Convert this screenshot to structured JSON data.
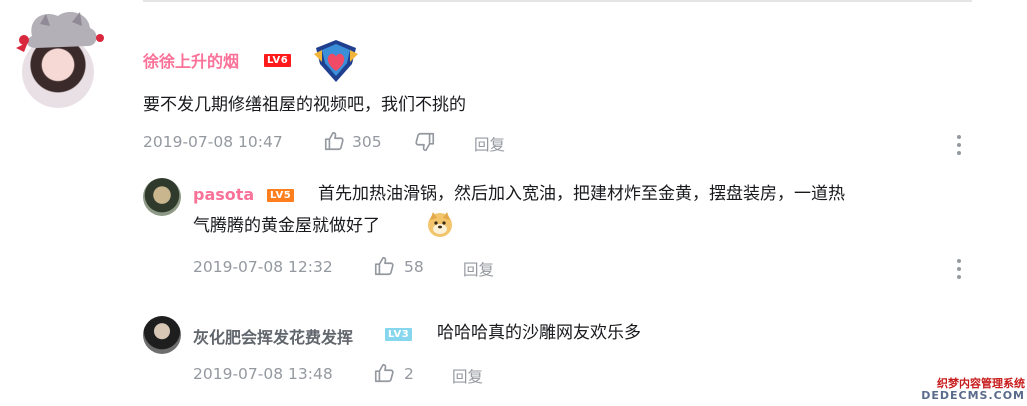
{
  "comments": [
    {
      "username": "徐徐上升的烟",
      "level": "LV6",
      "text": "要不发几期修缮祖屋的视频吧，我们不挑的",
      "time": "2019-07-08 10:47",
      "likes": "305",
      "reply_label": "回复"
    }
  ],
  "replies": [
    {
      "username": "pasota",
      "level": "LV5",
      "text_line1": "首先加热油滑锅，然后加入宽油，把建材炸至金黄，摆盘装房，一道热",
      "text_line2": "气腾腾的黄金屋就做好了",
      "emoji": "doge",
      "time": "2019-07-08 12:32",
      "likes": "58",
      "reply_label": "回复"
    },
    {
      "username": "灰化肥会挥发花费发挥",
      "level": "LV3",
      "text": "哈哈哈真的沙雕网友欢乐多",
      "time": "2019-07-08 13:48",
      "likes": "2",
      "reply_label": "回复"
    }
  ],
  "watermark": {
    "line1": "织梦内容管理系统",
    "line2": "DEDECMS.COM"
  },
  "colors": {
    "vip_name": "#fb7299",
    "meta_text": "#9499a0",
    "lv6": "#ff1b1b",
    "lv5": "#ff7e1d",
    "lv3": "#86d6ee"
  }
}
